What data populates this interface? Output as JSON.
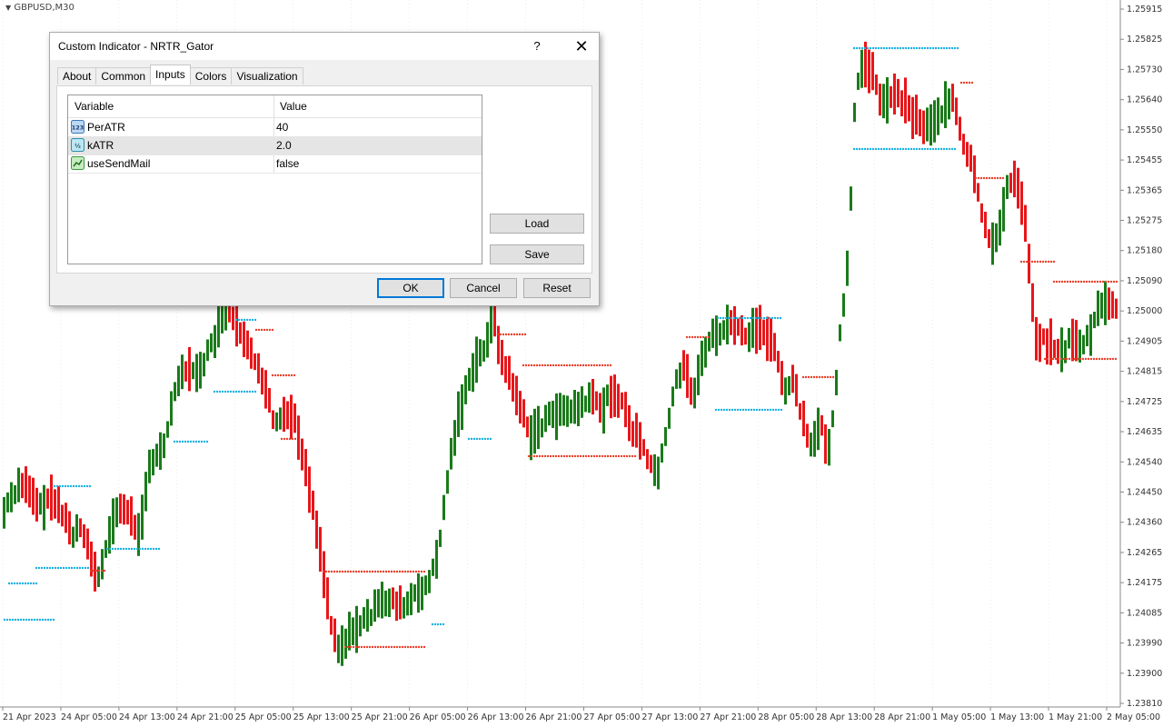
{
  "chart": {
    "symbol": "GBPUSD,M30",
    "price_labels": [
      "1.25915",
      "1.25825",
      "1.25730",
      "1.25640",
      "1.25550",
      "1.25455",
      "1.25365",
      "1.25275",
      "1.25180",
      "1.25090",
      "1.25000",
      "1.24905",
      "1.24815",
      "1.24725",
      "1.24635",
      "1.24540",
      "1.24450",
      "1.24360",
      "1.24265",
      "1.24175",
      "1.24085",
      "1.23990",
      "1.23900",
      "1.23810"
    ],
    "time_labels": [
      "21 Apr 2023",
      "24 Apr 05:00",
      "24 Apr 13:00",
      "24 Apr 21:00",
      "25 Apr 05:00",
      "25 Apr 13:00",
      "25 Apr 21:00",
      "26 Apr 05:00",
      "26 Apr 13:00",
      "26 Apr 21:00",
      "27 Apr 05:00",
      "27 Apr 13:00",
      "27 Apr 21:00",
      "28 Apr 05:00",
      "28 Apr 13:00",
      "28 Apr 21:00",
      "1 May 05:00",
      "1 May 13:00",
      "1 May 21:00",
      "2 May 05:00"
    ],
    "colors": {
      "bull": "#1a7a1a",
      "bear": "#e8161a",
      "support": "#19b0e0",
      "resistance": "#e8402a",
      "grid": "#d8d8d8"
    }
  },
  "dialog": {
    "title": "Custom Indicator - NRTR_Gator",
    "help_label": "?",
    "close_label": "✕",
    "tabs": [
      "About",
      "Common",
      "Inputs",
      "Colors",
      "Visualization"
    ],
    "active_tab": "Inputs",
    "table": {
      "headers": {
        "variable": "Variable",
        "value": "Value"
      },
      "rows": [
        {
          "name": "PerATR",
          "value": "40",
          "icon": "integer-icon"
        },
        {
          "name": "kATR",
          "value": "2.0",
          "icon": "double-icon"
        },
        {
          "name": "useSendMail",
          "value": "false",
          "icon": "bool-icon"
        }
      ]
    },
    "buttons": {
      "load": "Load",
      "save": "Save",
      "ok": "OK",
      "cancel": "Cancel",
      "reset": "Reset"
    }
  }
}
